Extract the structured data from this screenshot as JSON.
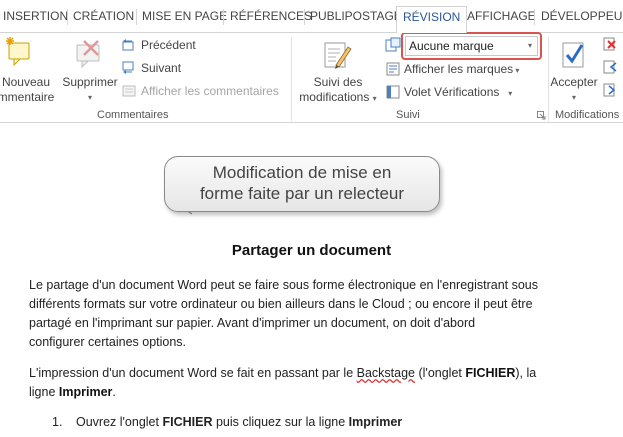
{
  "tabs": {
    "insertion": "INSERTION",
    "creation": "CRÉATION",
    "mise_en_page": "MISE EN PAGE",
    "references": "RÉFÉRENCES",
    "publipostage": "PUBLIPOSTAGE",
    "revision": "RÉVISION",
    "affichage": "AFFICHAGE",
    "developpeur": "DÉVELOPPEUR"
  },
  "ribbon": {
    "commentaires": {
      "nouveau_line1": "Nouveau",
      "nouveau_line2": "mmentaire",
      "supprimer": "Supprimer",
      "precedent": "Précédent",
      "suivant": "Suivant",
      "afficher_commentaires": "Afficher les commentaires",
      "label": "Commentaires"
    },
    "suivi": {
      "suivi_line1": "Suivi des",
      "suivi_line2": "modifications",
      "markup_value": "Aucune marque",
      "afficher_marques": "Afficher les marques",
      "volet": "Volet Vérifications",
      "label": "Suivi"
    },
    "modifications": {
      "accepter": "Accepter",
      "label": "Modifications"
    }
  },
  "callout": {
    "line1": "Modification de mise en",
    "line2": "forme faite par un relecteur"
  },
  "document": {
    "title": "Partager un document",
    "p1_l1": "Le partage d'un document Word peut se faire sous forme électronique en l'enregistrant sous",
    "p1_l2": "différents formats sur votre ordinateur ou bien ailleurs dans le Cloud ; ou encore il peut être",
    "p1_l3": "partagé en l'imprimant sur papier. Avant d'imprimer un document, on doit d'abord",
    "p1_l4": "configurer certaines options.",
    "p2_a": "L'impression d'un document Word se fait en passant par le ",
    "p2_backstage": "Backstage",
    "p2_b": " (l'onglet ",
    "p2_fichier": "FICHIER",
    "p2_c": "), la",
    "p2_d": "ligne ",
    "p2_imprimer": "Imprimer",
    "p2_e": ".",
    "li1_num": "1.",
    "li1_a": "Ouvrez l'onglet ",
    "li1_fichier": "FICHIER",
    "li1_b": " puis cliquez sur la ligne ",
    "li1_imprimer": "Imprimer"
  },
  "colors": {
    "active_tab": "#2b579a",
    "highlight": "#d9534f",
    "ribbon_border": "#d4d4d4"
  }
}
